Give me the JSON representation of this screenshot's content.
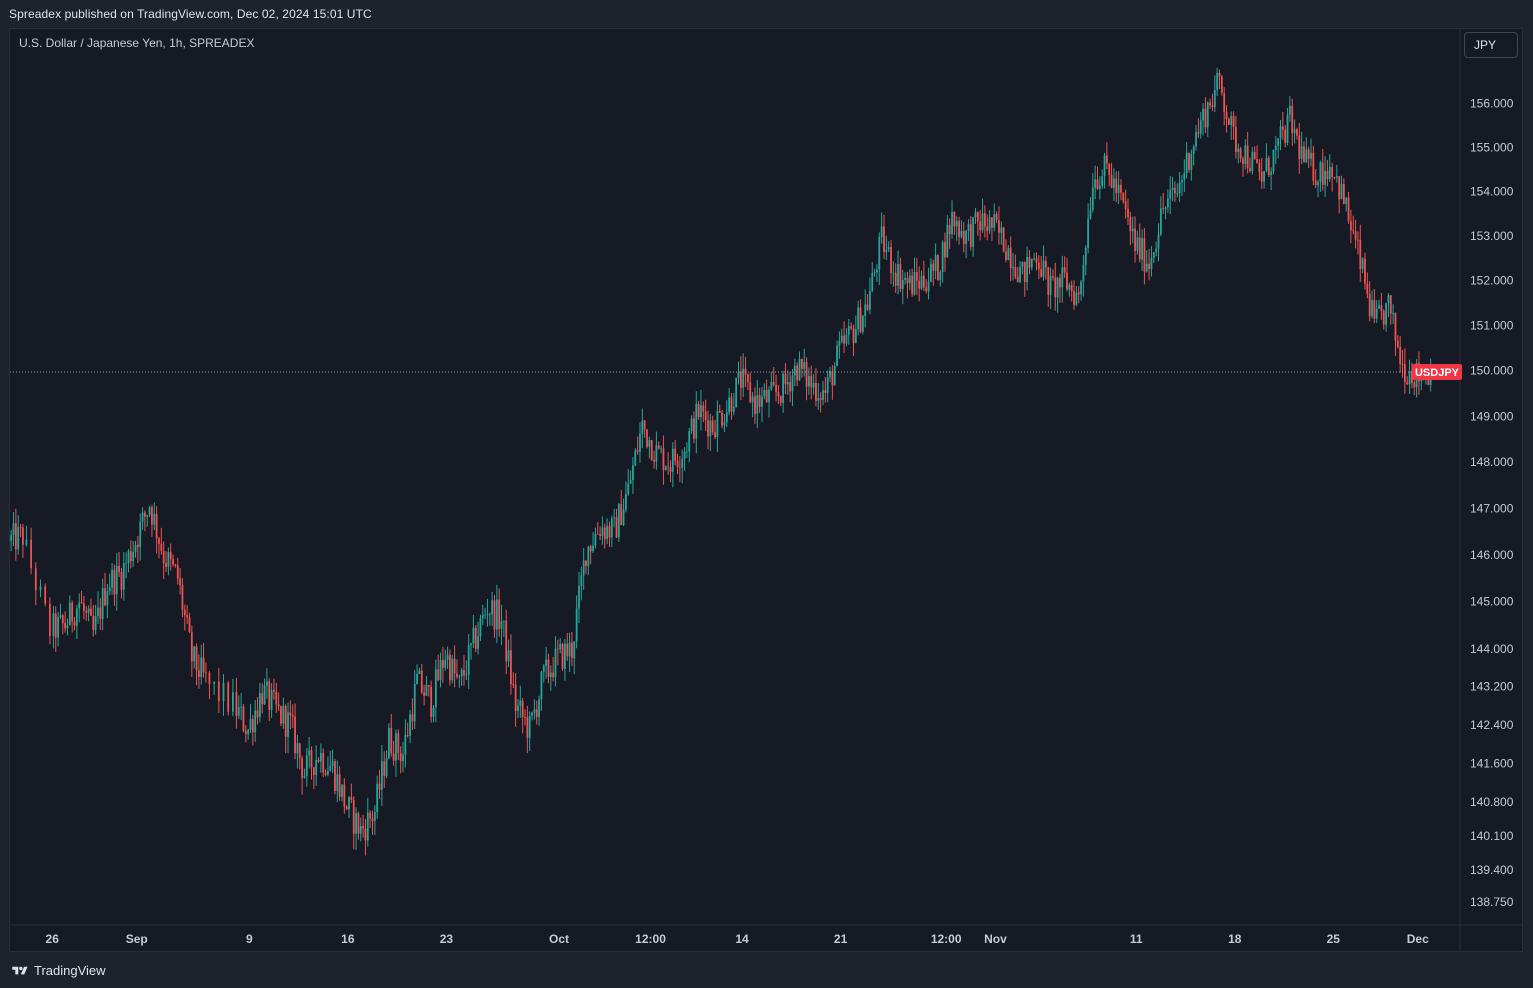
{
  "header": {
    "published": "Spreadex published on TradingView.com, Dec 02, 2024 15:01 UTC"
  },
  "chart_header": {
    "symbol": "U.S. Dollar / Japanese Yen, 1h, SPREADEX",
    "currency_button": "JPY"
  },
  "footer": {
    "brand": "TradingView"
  },
  "colors": {
    "background": "#161a25",
    "up": "#26a69a",
    "down": "#ef5350",
    "last_price_line": "#9598a1",
    "last_price_label": "#f23645"
  },
  "chart_data": {
    "type": "candlestick",
    "title": "U.S. Dollar / Japanese Yen, 1h, SPREADEX",
    "symbol_label": "USDJPY",
    "last_price": 149.97,
    "y_scale": "log",
    "ylim": [
      138.4,
      157.6
    ],
    "y_ticks": [
      "156.000",
      "155.000",
      "154.000",
      "153.000",
      "152.000",
      "151.000",
      "150.000",
      "149.000",
      "148.000",
      "147.000",
      "146.000",
      "145.000",
      "144.000",
      "143.200",
      "142.400",
      "141.600",
      "140.800",
      "140.100",
      "139.400",
      "138.750"
    ],
    "x_ticks": [
      "26",
      "Sep",
      "9",
      "16",
      "23",
      "Oct",
      "12:00",
      "14",
      "21",
      "12:00",
      "Nov",
      "11",
      "18",
      "25",
      "Dec"
    ],
    "x_tick_dates": [
      "2024-08-26",
      "2024-09-01",
      "2024-09-09",
      "2024-09-16",
      "2024-09-23",
      "2024-10-01",
      "2024-10-07T12:00",
      "2024-10-14",
      "2024-10-21",
      "2024-10-28T12:00",
      "2024-11-01",
      "2024-11-11",
      "2024-11-18",
      "2024-11-25",
      "2024-12-01"
    ],
    "xlim": [
      "2024-08-23",
      "2024-12-04"
    ],
    "close_path": [
      [
        "2024-08-23",
        146.3
      ],
      [
        "2024-08-24",
        146.4
      ],
      [
        "2024-08-26",
        144.4
      ],
      [
        "2024-08-27",
        144.5
      ],
      [
        "2024-08-28",
        145.0
      ],
      [
        "2024-08-29",
        144.3
      ],
      [
        "2024-08-30",
        145.4
      ],
      [
        "2024-08-31",
        145.6
      ],
      [
        "2024-09-01",
        146.3
      ],
      [
        "2024-09-02",
        147.1
      ],
      [
        "2024-09-03",
        146.0
      ],
      [
        "2024-09-04",
        145.5
      ],
      [
        "2024-09-05",
        143.8
      ],
      [
        "2024-09-06",
        143.3
      ],
      [
        "2024-09-08",
        142.8
      ],
      [
        "2024-09-09",
        142.3
      ],
      [
        "2024-09-10",
        143.1
      ],
      [
        "2024-09-11",
        142.7
      ],
      [
        "2024-09-12",
        142.4
      ],
      [
        "2024-09-13",
        141.4
      ],
      [
        "2024-09-14",
        141.8
      ],
      [
        "2024-09-15",
        141.5
      ],
      [
        "2024-09-16",
        140.7
      ],
      [
        "2024-09-17",
        140.2
      ],
      [
        "2024-09-18",
        140.6
      ],
      [
        "2024-09-19",
        142.1
      ],
      [
        "2024-09-20",
        141.8
      ],
      [
        "2024-09-21",
        143.3
      ],
      [
        "2024-09-22",
        142.9
      ],
      [
        "2024-09-23",
        143.9
      ],
      [
        "2024-09-24",
        143.2
      ],
      [
        "2024-09-25",
        144.1
      ],
      [
        "2024-09-26",
        144.9
      ],
      [
        "2024-09-27",
        144.6
      ],
      [
        "2024-09-28",
        142.8
      ],
      [
        "2024-09-29",
        142.3
      ],
      [
        "2024-09-30",
        143.4
      ],
      [
        "2024-10-01",
        143.8
      ],
      [
        "2024-10-02",
        144.0
      ],
      [
        "2024-10-03",
        146.1
      ],
      [
        "2024-10-04",
        146.6
      ],
      [
        "2024-10-05",
        146.5
      ],
      [
        "2024-10-06",
        147.4
      ],
      [
        "2024-10-07",
        148.8
      ],
      [
        "2024-10-08",
        148.2
      ],
      [
        "2024-10-09",
        148.0
      ],
      [
        "2024-10-10",
        148.3
      ],
      [
        "2024-10-11",
        149.1
      ],
      [
        "2024-10-12",
        148.8
      ],
      [
        "2024-10-13",
        149.2
      ],
      [
        "2024-10-14",
        149.8
      ],
      [
        "2024-10-15",
        149.3
      ],
      [
        "2024-10-16",
        149.4
      ],
      [
        "2024-10-17",
        149.6
      ],
      [
        "2024-10-18",
        150.1
      ],
      [
        "2024-10-19",
        149.7
      ],
      [
        "2024-10-20",
        149.5
      ],
      [
        "2024-10-21",
        150.4
      ],
      [
        "2024-10-22",
        150.9
      ],
      [
        "2024-10-23",
        151.5
      ],
      [
        "2024-10-24",
        152.9
      ],
      [
        "2024-10-25",
        152.2
      ],
      [
        "2024-10-26",
        151.9
      ],
      [
        "2024-10-27",
        152.0
      ],
      [
        "2024-10-28",
        152.3
      ],
      [
        "2024-10-29",
        153.4
      ],
      [
        "2024-10-30",
        153.0
      ],
      [
        "2024-10-31",
        153.3
      ],
      [
        "2024-11-01",
        153.2
      ],
      [
        "2024-11-02",
        152.7
      ],
      [
        "2024-11-03",
        152.1
      ],
      [
        "2024-11-04",
        152.6
      ],
      [
        "2024-11-05",
        151.8
      ],
      [
        "2024-11-06",
        152.0
      ],
      [
        "2024-11-07",
        151.6
      ],
      [
        "2024-11-08",
        154.3
      ],
      [
        "2024-11-09",
        154.5
      ],
      [
        "2024-11-10",
        153.8
      ],
      [
        "2024-11-11",
        152.8
      ],
      [
        "2024-11-12",
        152.4
      ],
      [
        "2024-11-13",
        153.6
      ],
      [
        "2024-11-14",
        154.0
      ],
      [
        "2024-11-15",
        155.0
      ],
      [
        "2024-11-16",
        155.8
      ],
      [
        "2024-11-17",
        156.5
      ],
      [
        "2024-11-18",
        155.2
      ],
      [
        "2024-11-19",
        154.8
      ],
      [
        "2024-11-20",
        154.3
      ],
      [
        "2024-11-21",
        154.9
      ],
      [
        "2024-11-22",
        155.6
      ],
      [
        "2024-11-23",
        154.7
      ],
      [
        "2024-11-24",
        154.4
      ],
      [
        "2024-11-25",
        154.6
      ],
      [
        "2024-11-26",
        153.6
      ],
      [
        "2024-11-27",
        152.4
      ],
      [
        "2024-11-28",
        151.0
      ],
      [
        "2024-11-29",
        151.4
      ],
      [
        "2024-11-30",
        150.1
      ],
      [
        "2024-12-01",
        149.9
      ],
      [
        "2024-12-02",
        150.0
      ]
    ]
  }
}
